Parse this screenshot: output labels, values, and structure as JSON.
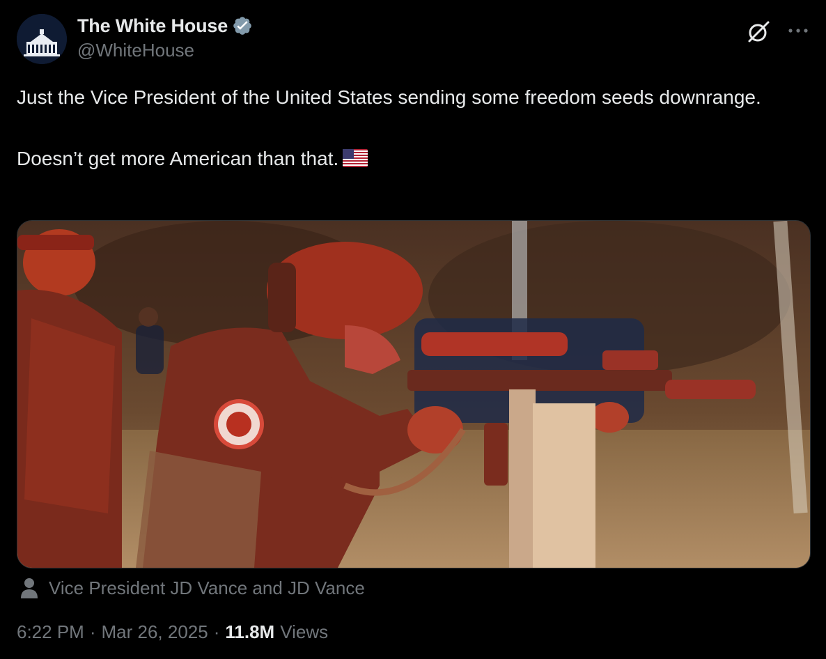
{
  "account": {
    "display_name": "The White House",
    "handle": "@WhiteHouse",
    "verified": true,
    "avatar_icon": "white-house-logo",
    "verified_icon": "verified-badge-icon",
    "verified_color": "#829aab"
  },
  "header_actions": {
    "grok_icon": "grok-icon",
    "more_icon": "more-options-icon"
  },
  "tweet": {
    "line1": "Just the Vice President of the United States sending some freedom seeds downrange.",
    "line2": "Doesn’t get more American than that.",
    "emoji": "us-flag-emoji"
  },
  "media": {
    "type": "photo"
  },
  "tagged": {
    "icon": "person-icon",
    "text": "Vice President JD Vance and JD Vance"
  },
  "meta": {
    "time": "6:22 PM",
    "separator": "·",
    "date": "Mar 26, 2025",
    "views_count": "11.8M",
    "views_label": "Views"
  },
  "colors": {
    "background": "#000000",
    "primary_text": "#e7e9ea",
    "secondary_text": "#71767b"
  }
}
